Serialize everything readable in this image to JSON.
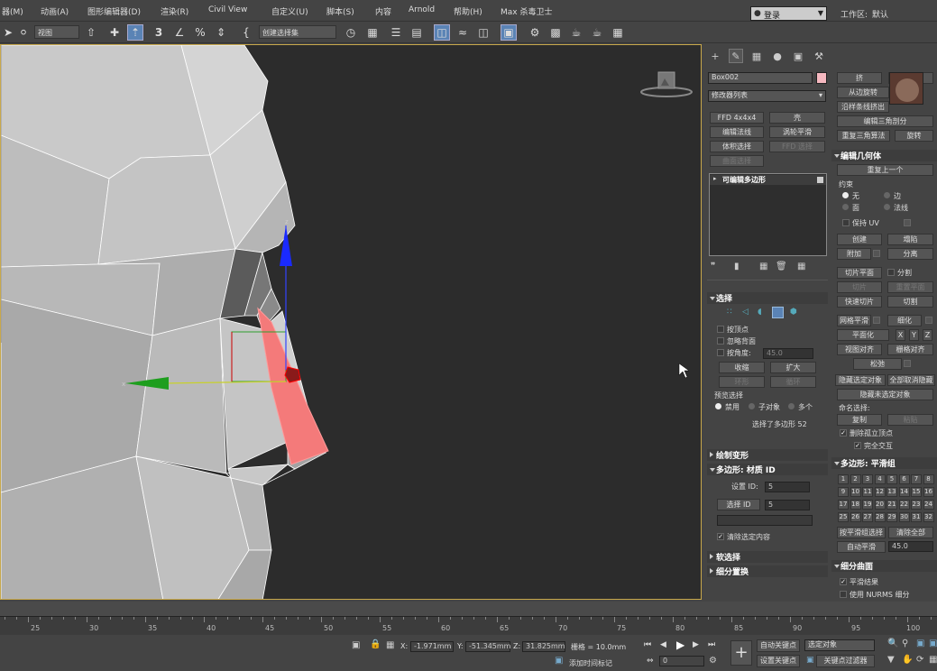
{
  "menu": [
    "器(M)",
    "动画(A)",
    "图形编辑器(D)",
    "渲染(R)",
    "Civil View",
    "自定义(U)",
    "脚本(S)",
    "内容",
    "Arnold",
    "帮助(H)",
    "Max 杀毒卫士"
  ],
  "search": {
    "label": "登录"
  },
  "workspace": {
    "label": "工作区:",
    "value": "默认"
  },
  "toolbar": {
    "view_select": "视图",
    "selset": "创建选择集",
    "angle": "3"
  },
  "object": {
    "name": "Box002",
    "color": "#f5b8c0"
  },
  "modlist": {
    "label": "修改器列表"
  },
  "mod_buttons": [
    "FFD 4x4x4",
    "壳",
    "编辑法线",
    "涡轮平滑",
    "体积选择",
    "FFD 选择",
    "曲面选择"
  ],
  "stack": {
    "item": "可编辑多边形"
  },
  "selection": {
    "title": "选择",
    "by_vertex": "按顶点",
    "ignore_back": "忽略背面",
    "by_angle": "按角度:",
    "angle_val": "45.0",
    "shrink": "收缩",
    "grow": "扩大",
    "ring": "环形",
    "loop": "循环",
    "preview": "预览选择",
    "opt_disable": "禁用",
    "opt_sub": "子对象",
    "opt_multi": "多个",
    "status": "选择了多边形 52"
  },
  "soft_deform": {
    "title": "绘制变形"
  },
  "mat_id": {
    "title": "多边形: 材质 ID",
    "set_id": "设置 ID:",
    "set_val": "5",
    "sel_id": "选择 ID",
    "sel_val": "5",
    "clear": "清除选定内容"
  },
  "soft_sel": {
    "title": "软选择"
  },
  "subdiv_disp": {
    "title": "细分置换"
  },
  "right": {
    "b1": "挤",
    "b2": "倒角",
    "b3": "从边旋转",
    "b4": "沿样条线挤出",
    "b5": "编辑三角剖分",
    "b6": "重复三角算法",
    "b7": "旋转",
    "edit_geo": "编辑几何体",
    "repeat": "重复上一个",
    "constraint": "约束",
    "c_none": "无",
    "c_edge": "边",
    "c_face": "面",
    "c_normal": "法线",
    "keep_uv": "保持 UV",
    "create": "创建",
    "collapse": "塌陷",
    "attach": "附加",
    "detach": "分离",
    "slice_plane": "切片平面",
    "split": "分割",
    "slice": "切片",
    "reset_plane": "重置平面",
    "quickslice": "快速切片",
    "cut": "切割",
    "meshsmooth": "网格平滑",
    "tessellate": "细化",
    "planarize": "平面化",
    "x": "X",
    "y": "Y",
    "z": "Z",
    "view_align": "视图对齐",
    "grid_align": "栅格对齐",
    "relax": "松弛",
    "hide_sel": "隐藏选定对象",
    "unhide_all": "全部取消隐藏",
    "hide_unsel": "隐藏未选定对象",
    "named_sel": "命名选择:",
    "copy": "复制",
    "paste": "粘贴",
    "del_iso": "删除孤立顶点",
    "full_inter": "完全交互",
    "smooth_group": "多边形: 平滑组",
    "groups": [
      "1",
      "2",
      "3",
      "4",
      "5",
      "6",
      "7",
      "8",
      "9",
      "10",
      "11",
      "12",
      "13",
      "14",
      "15",
      "16",
      "17",
      "18",
      "19",
      "20",
      "21",
      "22",
      "23",
      "24",
      "25",
      "26",
      "27",
      "28",
      "29",
      "30",
      "31",
      "32"
    ],
    "sel_by_sg": "按平滑组选择",
    "clear_all": "清除全部",
    "autosmooth": "自动平滑",
    "as_val": "45.0",
    "subdiv_surface": "细分曲面",
    "smooth_result": "平滑结果",
    "use_nurms": "使用 NURMS 细分"
  },
  "ruler": [
    "25",
    "30",
    "35",
    "40",
    "45",
    "50",
    "55",
    "60",
    "65",
    "70",
    "75",
    "80",
    "85",
    "90",
    "95",
    "100"
  ],
  "status": {
    "x_label": "X:",
    "x_val": "-1.971mm",
    "y_label": "Y:",
    "y_val": "-51.345mm",
    "z_label": "Z:",
    "z_val": "31.825mm",
    "grid": "栅格 = 10.0mm",
    "add_tag": "添加时间标记",
    "auto_key": "自动关键点",
    "set_key": "设置关键点",
    "sel_obj": "选定对象",
    "key_filter": "关键点过滤器",
    "frame": "0"
  },
  "colors": {
    "accent": "#5a83b5",
    "viewport_border": "#c8a84b",
    "poly_sel": "#f47a7a"
  }
}
